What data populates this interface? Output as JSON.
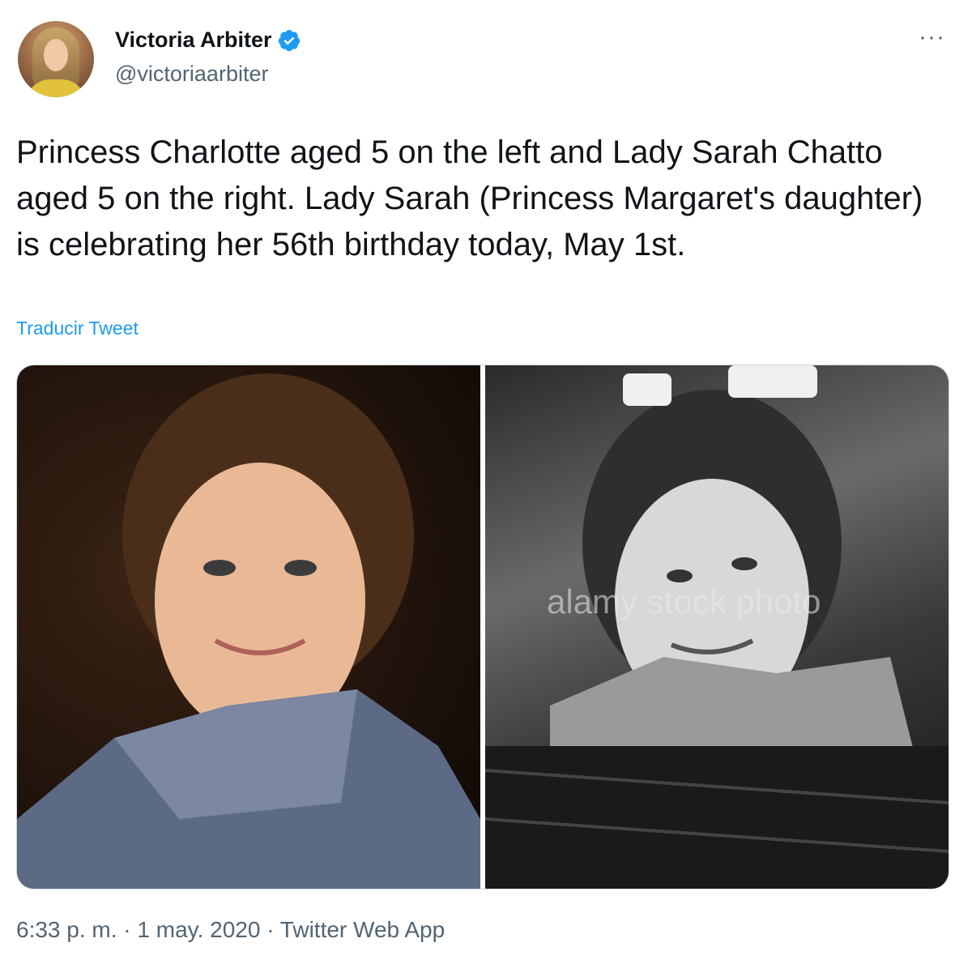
{
  "tweet": {
    "author_name": "Victoria Arbiter",
    "author_handle": "@victoriaarbiter",
    "text": "Princess Charlotte aged 5 on the left and Lady Sarah Chatto aged 5 on the right. Lady Sarah (Princess Margaret's daughter) is celebrating her 56th birthday today, May 1st.",
    "translate_label": "Traducir Tweet",
    "timestamp": "6:33 p. m. · 1 may. 2020 · Twitter Web App",
    "more_icon": "more-horizontal-icon",
    "verified_icon": "verified-badge-icon",
    "media": {
      "watermark": "alamy stock photo"
    }
  },
  "colors": {
    "link": "#1d9bf0",
    "secondary_text": "#536471",
    "primary_text": "#0f1419"
  }
}
